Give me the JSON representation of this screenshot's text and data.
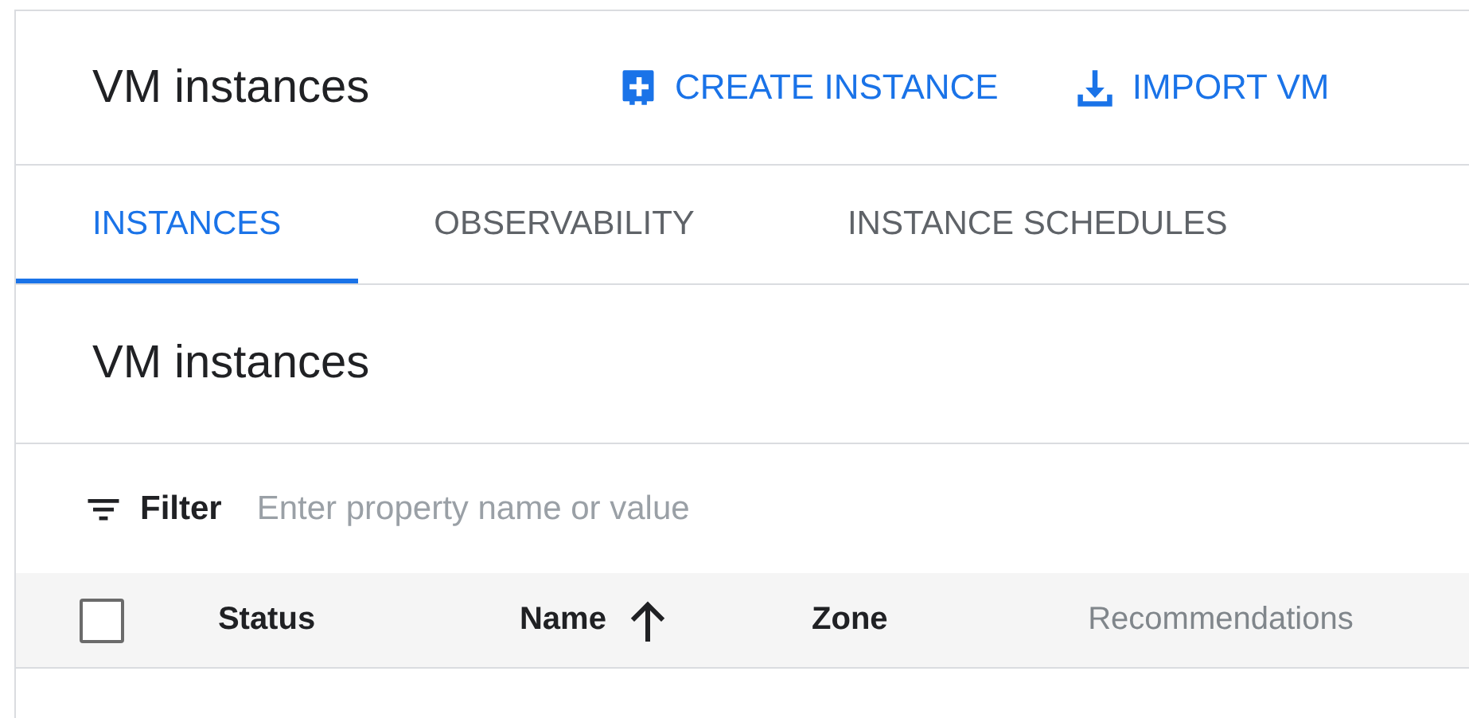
{
  "header": {
    "title": "VM instances",
    "actions": [
      {
        "label": "CREATE INSTANCE",
        "kind": "create"
      },
      {
        "label": "IMPORT VM",
        "kind": "import"
      }
    ]
  },
  "tabs": [
    {
      "label": "INSTANCES",
      "selected": true
    },
    {
      "label": "OBSERVABILITY",
      "selected": false
    },
    {
      "label": "INSTANCE SCHEDULES",
      "selected": false
    }
  ],
  "section_title": "VM instances",
  "filter": {
    "label": "Filter",
    "placeholder": "Enter property name or value"
  },
  "table": {
    "select_all": {
      "checked": false
    },
    "columns": [
      {
        "label": "Status",
        "sorted": false,
        "dimmed": false
      },
      {
        "label": "Name",
        "sorted": true,
        "dimmed": false
      },
      {
        "label": "Zone",
        "sorted": false,
        "dimmed": false
      },
      {
        "label": "Recommendations",
        "sorted": false,
        "dimmed": true
      }
    ]
  }
}
